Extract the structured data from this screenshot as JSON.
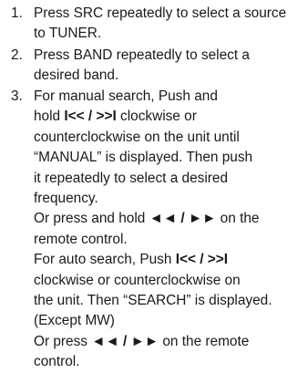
{
  "steps": [
    {
      "number": "1.",
      "lines": [
        "Press SRC repeatedly to select a source",
        "to TUNER."
      ]
    },
    {
      "number": "2.",
      "lines": [
        "Press BAND repeatedly to select a",
        "desired band."
      ]
    },
    {
      "number": "3.",
      "l1": "For manual search, Push and",
      "l2_pre": "hold",
      "l2_sym": "I<< / >>I",
      "l2_post": "clockwise or",
      "l3": "counterclockwise on the unit until",
      "l4": "“MANUAL” is displayed. Then push",
      "l5": "it repeatedly to select a desired",
      "l6": "frequency.",
      "l7_pre": "Or press and hold",
      "l7_sym": "◄◄ / ►►",
      "l7_post": "on the",
      "l8": "remote control.",
      "l9_pre": "For auto search, Push",
      "l9_sym": "I<< / >>I",
      "l10": "clockwise or counterclockwise on",
      "l11": "the unit. Then “SEARCH” is displayed.",
      "l12": "(Except MW)",
      "l13_pre": "Or press",
      "l13_sym": "◄◄ / ►►",
      "l13_post": "on the remote",
      "l14": "control."
    }
  ]
}
